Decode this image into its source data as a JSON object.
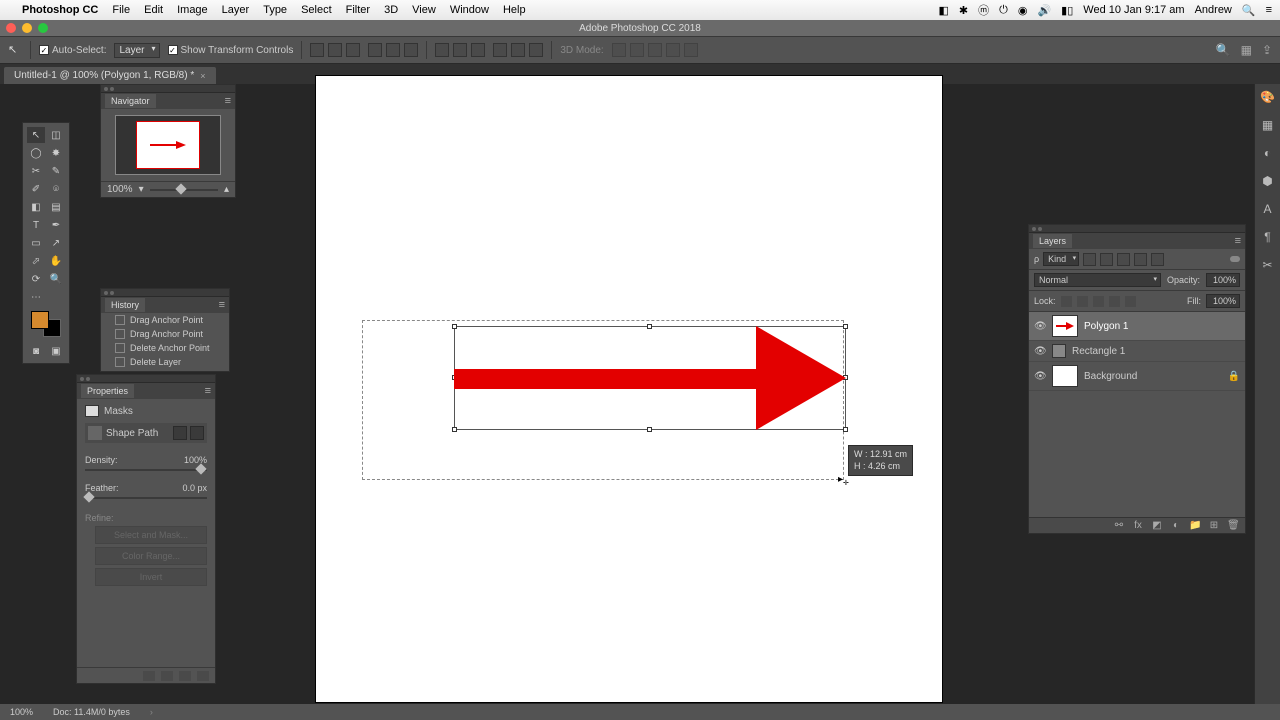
{
  "menubar": {
    "app": "Photoshop CC",
    "items": [
      "File",
      "Edit",
      "Image",
      "Layer",
      "Type",
      "Select",
      "Filter",
      "3D",
      "View",
      "Window",
      "Help"
    ],
    "clock": "Wed 10 Jan  9:17 am",
    "user": "Andrew"
  },
  "titlebar": "Adobe Photoshop CC 2018",
  "optionsbar": {
    "auto_select": "Auto-Select:",
    "auto_select_target": "Layer",
    "show_transform": "Show Transform Controls",
    "mode_label": "3D Mode:"
  },
  "document_tab": "Untitled-1 @ 100% (Polygon 1, RGB/8) *",
  "navigator": {
    "title": "Navigator",
    "zoom": "100%"
  },
  "history": {
    "title": "History",
    "items": [
      "Drag Anchor Point",
      "Drag Anchor Point",
      "Delete Anchor Point",
      "Delete Layer"
    ]
  },
  "properties": {
    "title": "Properties",
    "masks": "Masks",
    "shape_path": "Shape Path",
    "density_label": "Density:",
    "density_value": "100%",
    "feather_label": "Feather:",
    "feather_value": "0.0 px",
    "refine_label": "Refine:",
    "select_mask": "Select and Mask...",
    "color_range": "Color Range...",
    "invert": "Invert"
  },
  "canvas": {
    "measure_w": "W : 12.91 cm",
    "measure_h": "H : 4.26 cm",
    "arrow_color": "#e30000"
  },
  "layers": {
    "title": "Layers",
    "kind": "Kind",
    "blend": "Normal",
    "opacity_label": "Opacity:",
    "opacity": "100%",
    "lock_label": "Lock:",
    "fill_label": "Fill:",
    "fill": "100%",
    "items": [
      {
        "name": "Polygon 1",
        "selected": true
      },
      {
        "name": "Rectangle 1",
        "selected": false
      },
      {
        "name": "Background",
        "selected": false,
        "locked": true
      }
    ]
  },
  "statusbar": {
    "zoom": "100%",
    "doc": "Doc: 11.4M/0 bytes"
  }
}
